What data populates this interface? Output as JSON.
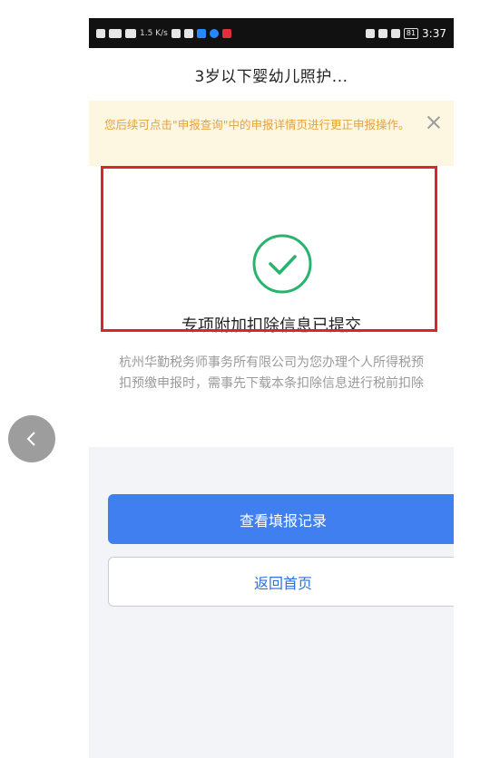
{
  "status_bar": {
    "network": "1.5 K/s",
    "battery": "81",
    "time": "3:37"
  },
  "nav": {
    "title": "3岁以下婴幼儿照护..."
  },
  "notice": {
    "text": "您后续可点击\"申报查询\"中的申报详情页进行更正申报操作。"
  },
  "result": {
    "title": "专项附加扣除信息已提交",
    "description": "杭州华勤税务师事务所有限公司为您办理个人所得税预扣预缴申报时，需事先下载本条扣除信息进行税前扣除"
  },
  "buttons": {
    "view_records": "查看填报记录",
    "back_home": "返回首页"
  },
  "colors": {
    "accent_blue": "#3f7fef",
    "success_green": "#28b46e",
    "notice_text": "#e3a33f",
    "notice_bg": "#fdf6e0",
    "highlight_red": "#d8262d"
  }
}
